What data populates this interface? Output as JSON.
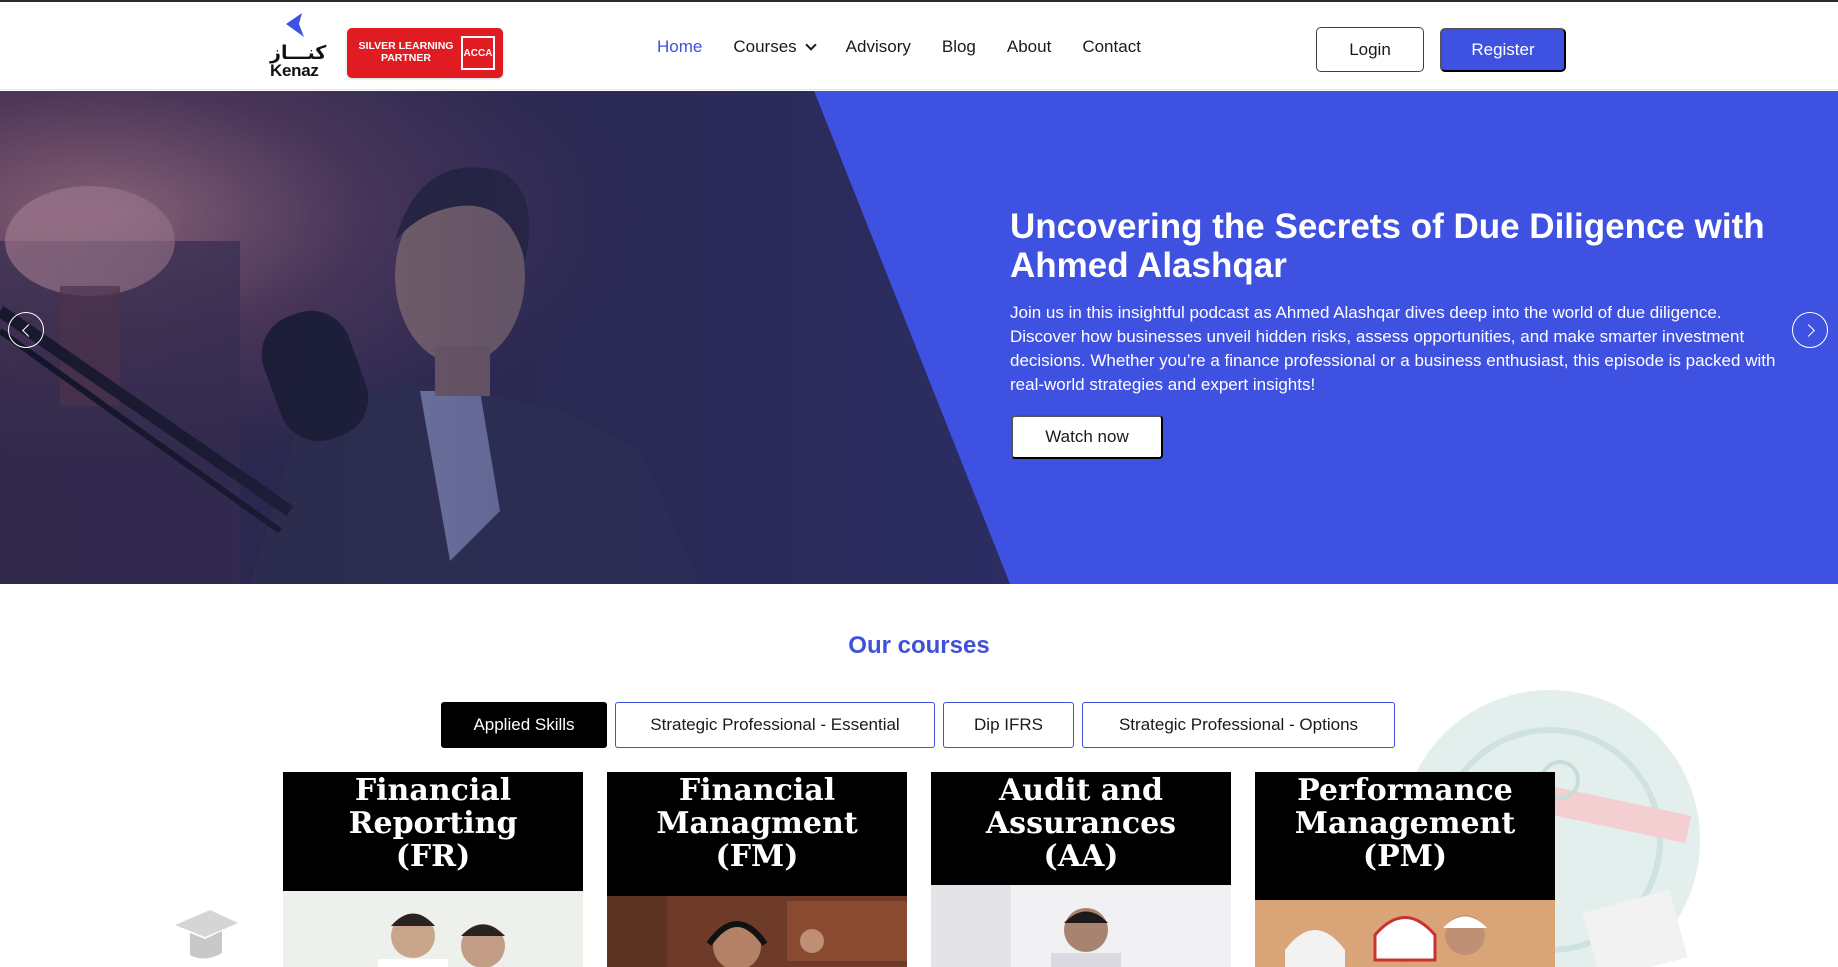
{
  "header": {
    "logo": {
      "arabic": "كنـــاز",
      "latin": "Kenaz",
      "icon": "kenaz-logo-icon"
    },
    "partner_badge": {
      "line1": "SILVER LEARNING",
      "line2": "PARTNER",
      "logo_text": "ACCA",
      "color": "#e01b22"
    },
    "nav": [
      {
        "label": "Home",
        "active": true
      },
      {
        "label": "Courses",
        "has_dropdown": true
      },
      {
        "label": "Advisory"
      },
      {
        "label": "Blog"
      },
      {
        "label": "About"
      },
      {
        "label": "Contact"
      }
    ],
    "login_label": "Login",
    "register_label": "Register"
  },
  "hero": {
    "title": "Uncovering the Secrets of Due Diligence with Ahmed Alashqar",
    "description": "Join us in this insightful podcast as Ahmed Alashqar dives deep into the world of due diligence. Discover how businesses unveil hidden risks, assess opportunities, and make smarter investment decisions. Whether you’re a finance professional or a business enthusiast, this episode is packed with real-world strategies and expert insights!",
    "cta_label": "Watch now",
    "prev_icon": "chevron-left-icon",
    "next_icon": "chevron-right-icon",
    "accent_color": "#3f51e0"
  },
  "courses": {
    "heading": "Our courses",
    "tabs": [
      {
        "label": "Applied Skills",
        "active": true
      },
      {
        "label": "Strategic Professional - Essential"
      },
      {
        "label": "Dip IFRS"
      },
      {
        "label": "Strategic Professional - Options"
      }
    ],
    "cards": [
      {
        "line1": "Financial",
        "line2": "Reporting",
        "line3": "(FR)"
      },
      {
        "line1": "Financial",
        "line2": "Managment",
        "line3": "(FM)"
      },
      {
        "line1": "Audit and",
        "line2": "Assurances",
        "line3": "(AA)"
      },
      {
        "line1": "Performance",
        "line2": "Management",
        "line3": "(PM)"
      }
    ]
  }
}
